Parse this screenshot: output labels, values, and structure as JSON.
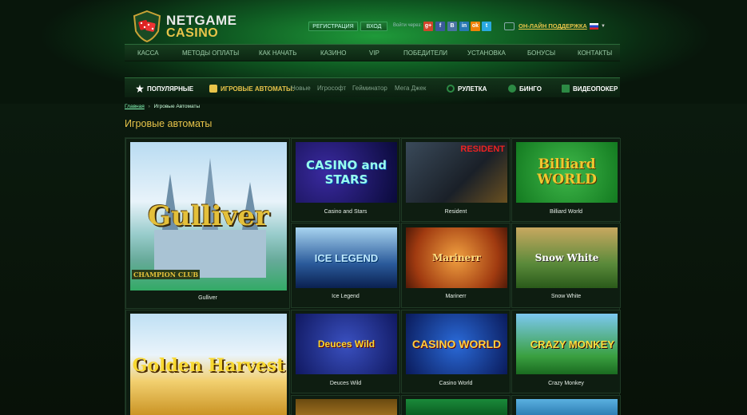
{
  "header": {
    "logo": {
      "line1": "NETGAME",
      "line2": "CASINO"
    },
    "register_label": "Регистрация",
    "login_label": "Вход",
    "via_label": "Войти через:",
    "social": [
      {
        "name": "gplus",
        "text": "g+",
        "color": "#d0452b"
      },
      {
        "name": "facebook",
        "text": "f",
        "color": "#3b5a9b"
      },
      {
        "name": "vk",
        "text": "B",
        "color": "#4a73a3"
      },
      {
        "name": "linkedin",
        "text": "in",
        "color": "#2878b4"
      },
      {
        "name": "odnoklassniki",
        "text": "ok",
        "color": "#ee8208"
      },
      {
        "name": "twitter",
        "text": "t",
        "color": "#2aa9e0"
      }
    ],
    "support_label": "ОН-ЛАЙН ПОДДЕРЖКА"
  },
  "main_nav": [
    "КАССА",
    "МЕТОДЫ ОПЛАТЫ",
    "КАК НАЧАТЬ",
    "КАЗИНО",
    "VIP",
    "ПОБЕДИТЕЛИ",
    "УСТАНОВКА",
    "БОНУСЫ",
    "КОНТАКТЫ"
  ],
  "category_bar": {
    "popular": "ПОПУЛЯРНЫЕ",
    "slots": "ИГРОВЫЕ АВТОМАТЫ:",
    "sub": [
      "Новые",
      "Игрософт",
      "Гейминатор",
      "Мега Джек"
    ],
    "roulette": "РУЛЕТКА",
    "bingo": "БИНГО",
    "videopoker": "ВИДЕОПОКЕР"
  },
  "breadcrumb": {
    "home": "Главная",
    "current": "Игровые Автоматы"
  },
  "page_title": "Игровые автоматы",
  "games": [
    {
      "name": "Gulliver",
      "thumb_text": "Gulliver"
    },
    {
      "name": "Casino and Stars",
      "thumb_text": "CASINO and STARS"
    },
    {
      "name": "Resident",
      "thumb_text": "RESIDENT"
    },
    {
      "name": "Billiard World",
      "thumb_text": "Billiard WORLD"
    },
    {
      "name": "Ice Legend",
      "thumb_text": "ICE LEGEND"
    },
    {
      "name": "Marinerr",
      "thumb_text": "Marinerr"
    },
    {
      "name": "Snow White",
      "thumb_text": "Snow White"
    },
    {
      "name": "Golden Harvest",
      "thumb_text": "Golden Harvest"
    },
    {
      "name": "Deuces Wild",
      "thumb_text": "Deuces Wild"
    },
    {
      "name": "Casino World",
      "thumb_text": "CASINO WORLD"
    },
    {
      "name": "Crazy Monkey",
      "thumb_text": "CRAZY MONKEY"
    }
  ],
  "gulliver_badge": "CHAMPION CLUB",
  "colors": {
    "accent": "#e8c44a",
    "nav_green": "#1f7a34"
  }
}
